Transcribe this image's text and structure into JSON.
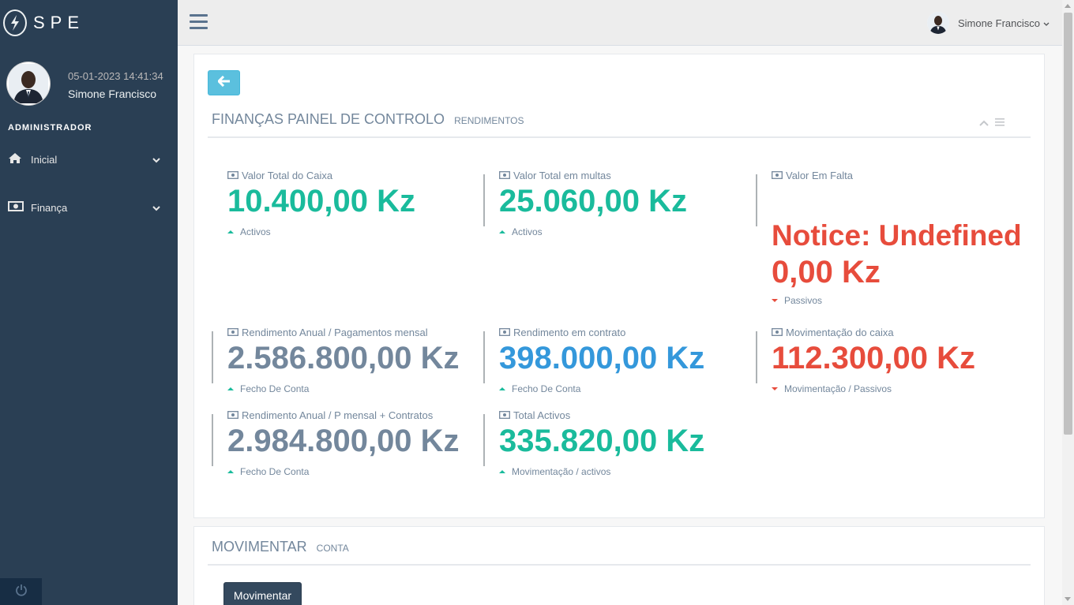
{
  "brand": {
    "name": "SPE"
  },
  "profile": {
    "date": "05-01-2023 14:41:34",
    "name": "Simone Francisco"
  },
  "sidebar": {
    "section": "ADMINISTRADOR",
    "items": [
      {
        "label": "Inicial",
        "icon": "home-icon"
      },
      {
        "label": "Finança",
        "icon": "money-icon"
      }
    ]
  },
  "topnav": {
    "user_name": "Simone Francisco"
  },
  "dashboard": {
    "title": "FINANÇAS PAINEL DE CONTROLO",
    "subtitle": "RENDIMENTOS",
    "stats": [
      {
        "label": "Valor Total do Caixa",
        "value": "10.400,00 Kz",
        "sub": "Activos",
        "color": "#1abb9c",
        "trend": "up"
      },
      {
        "label": "Valor Total em multas",
        "value": "25.060,00 Kz",
        "sub": "Activos",
        "color": "#1abb9c",
        "trend": "up"
      },
      {
        "label": "Valor Em Falta",
        "notice": "Notice: Undefined",
        "value": "0,00 Kz",
        "sub": "Passivos",
        "color": "#e74c3c",
        "trend": "down"
      },
      {
        "label": "Rendimento Anual / Pagamentos mensal",
        "value": "2.586.800,00 Kz",
        "sub": "Fecho De Conta",
        "color": "#73879c",
        "trend": "up"
      },
      {
        "label": "Rendimento em contrato",
        "value": "398.000,00 Kz",
        "sub": "Fecho De Conta",
        "color": "#3498db",
        "trend": "up"
      },
      {
        "label": "Movimentação do caixa",
        "value": "112.300,00 Kz",
        "sub": "Movimentação / Passivos",
        "color": "#e74c3c",
        "trend": "down"
      },
      {
        "label": "Rendimento Anual / P mensal + Contratos",
        "value": "2.984.800,00 Kz",
        "sub": "Fecho De Conta",
        "color": "#73879c",
        "trend": "up"
      },
      {
        "label": "Total Activos",
        "value": "335.820,00 Kz",
        "sub": "Movimentação / activos",
        "color": "#1abb9c",
        "trend": "up"
      }
    ]
  },
  "movimentar": {
    "title": "MOVIMENTAR",
    "subtitle": "CONTA",
    "button_label": "Movimentar"
  }
}
